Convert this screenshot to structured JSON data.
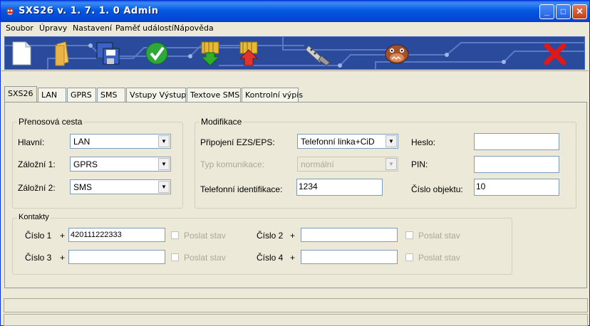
{
  "window": {
    "title": "SXS26 v. 1. 7. 1. 0 Admin"
  },
  "menu": [
    "Soubor",
    "Úpravy",
    "Nastavení",
    "Paměť událostí",
    "Nápověda"
  ],
  "toolbar": {
    "icons": [
      "new-file-icon",
      "open-folder-icon",
      "save-icon",
      "confirm-check-icon",
      "download-arrow-icon",
      "upload-arrow-icon",
      "serial-connector-icon",
      "bulldog-icon",
      "exit-x-icon"
    ]
  },
  "tabs": [
    "SXS26",
    "LAN",
    "GPRS",
    "SMS",
    "Vstupy Výstupy",
    "Textove SMS",
    "Kontrolní výpis"
  ],
  "transfer": {
    "legend": "Přenosová cesta",
    "main_label": "Hlavní:",
    "main_value": "LAN",
    "backup1_label": "Záložní 1:",
    "backup1_value": "GPRS",
    "backup2_label": "Záložní 2:",
    "backup2_value": "SMS"
  },
  "modification": {
    "legend": "Modifikace",
    "ezs_label": "Připojení EZS/EPS:",
    "ezs_value": "Telefonní linka+CiD",
    "comm_type_label": "Typ komunikace:",
    "comm_type_value": "normální",
    "phone_id_label": "Telefonní identifikace:",
    "phone_id_value": "1234",
    "password_label": "Heslo:",
    "password_value": "",
    "pin_label": "PIN:",
    "pin_value": "",
    "object_label": "Číslo objektu:",
    "object_value": "10"
  },
  "contacts": {
    "legend": "Kontakty",
    "plus": "+",
    "send_status": "Poslat stav",
    "items": [
      {
        "label": "Číslo 1",
        "value": "420111222333"
      },
      {
        "label": "Číslo 2",
        "value": ""
      },
      {
        "label": "Číslo 3",
        "value": ""
      },
      {
        "label": "Číslo 4",
        "value": ""
      }
    ]
  }
}
